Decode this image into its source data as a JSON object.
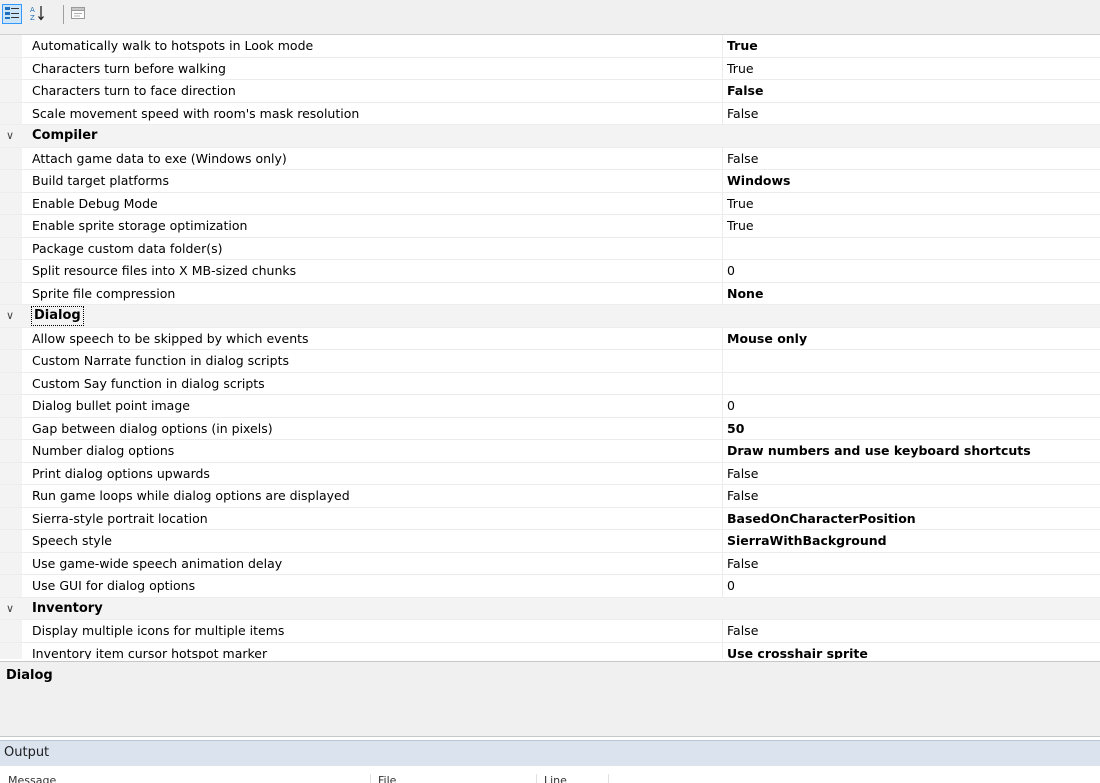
{
  "toolbar": {
    "buttons": [
      {
        "icon": "categorized-icon",
        "active": true
      },
      {
        "icon": "sort-alphabetical-icon",
        "active": false
      },
      {
        "icon": "property-pages-icon",
        "active": false
      }
    ]
  },
  "rows": [
    {
      "type": "prop",
      "name": "Automatically walk to hotspots in Look mode",
      "value": "True",
      "bold": true
    },
    {
      "type": "prop",
      "name": "Characters turn before walking",
      "value": "True",
      "bold": false
    },
    {
      "type": "prop",
      "name": "Characters turn to face direction",
      "value": "False",
      "bold": true
    },
    {
      "type": "prop",
      "name": "Scale movement speed with room's mask resolution",
      "value": "False",
      "bold": false
    },
    {
      "type": "cat",
      "name": "Compiler"
    },
    {
      "type": "prop",
      "name": "Attach game data to exe (Windows only)",
      "value": "False",
      "bold": false
    },
    {
      "type": "prop",
      "name": "Build target platforms",
      "value": "Windows",
      "bold": true
    },
    {
      "type": "prop",
      "name": "Enable Debug Mode",
      "value": "True",
      "bold": false
    },
    {
      "type": "prop",
      "name": "Enable sprite storage optimization",
      "value": "True",
      "bold": false
    },
    {
      "type": "prop",
      "name": "Package custom data folder(s)",
      "value": "",
      "bold": false
    },
    {
      "type": "prop",
      "name": "Split resource files into X MB-sized chunks",
      "value": "0",
      "bold": false
    },
    {
      "type": "prop",
      "name": "Sprite file compression",
      "value": "None",
      "bold": true
    },
    {
      "type": "cat",
      "name": "Dialog",
      "selected": true
    },
    {
      "type": "prop",
      "name": "Allow speech to be skipped by which events",
      "value": "Mouse only",
      "bold": true
    },
    {
      "type": "prop",
      "name": "Custom Narrate function in dialog scripts",
      "value": "",
      "bold": false
    },
    {
      "type": "prop",
      "name": "Custom Say function in dialog scripts",
      "value": "",
      "bold": false
    },
    {
      "type": "prop",
      "name": "Dialog bullet point image",
      "value": "0",
      "bold": false
    },
    {
      "type": "prop",
      "name": "Gap between dialog options (in pixels)",
      "value": "50",
      "bold": true
    },
    {
      "type": "prop",
      "name": "Number dialog options",
      "value": "Draw numbers and use keyboard shortcuts",
      "bold": true
    },
    {
      "type": "prop",
      "name": "Print dialog options upwards",
      "value": "False",
      "bold": false
    },
    {
      "type": "prop",
      "name": "Run game loops while dialog options are displayed",
      "value": "False",
      "bold": false
    },
    {
      "type": "prop",
      "name": "Sierra-style portrait location",
      "value": "BasedOnCharacterPosition",
      "bold": true
    },
    {
      "type": "prop",
      "name": "Speech style",
      "value": "SierraWithBackground",
      "bold": true
    },
    {
      "type": "prop",
      "name": "Use game-wide speech animation delay",
      "value": "False",
      "bold": false
    },
    {
      "type": "prop",
      "name": "Use GUI for dialog options",
      "value": "0",
      "bold": false
    },
    {
      "type": "cat",
      "name": "Inventory"
    },
    {
      "type": "prop",
      "name": "Display multiple icons for multiple items",
      "value": "False",
      "bold": false
    },
    {
      "type": "prop",
      "name": "Inventory item cursor hotspot marker",
      "value": "Use crosshair sprite",
      "bold": true
    }
  ],
  "description": {
    "title": "Dialog"
  },
  "output": {
    "title": "Output",
    "columns": [
      "Message",
      "File",
      "Line"
    ]
  },
  "colors": {
    "selection_blue": "#3399ff",
    "category_bg": "#f3f3f3",
    "output_header_bg": "#dae3ee"
  }
}
